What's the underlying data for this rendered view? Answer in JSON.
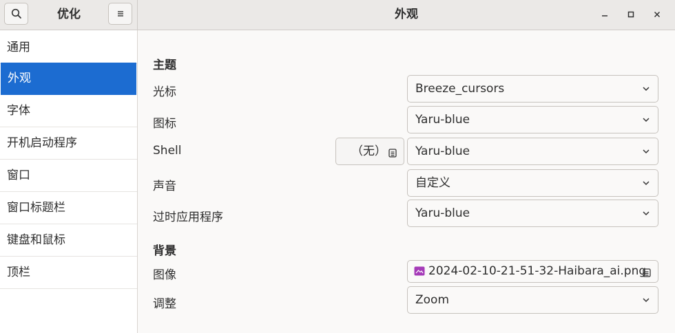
{
  "sidebar_header": {
    "title": "优化"
  },
  "window": {
    "title": "外观"
  },
  "sidebar": {
    "items": [
      {
        "label": "通用"
      },
      {
        "label": "外观"
      },
      {
        "label": "字体"
      },
      {
        "label": "开机启动程序"
      },
      {
        "label": "窗口"
      },
      {
        "label": "窗口标题栏"
      },
      {
        "label": "键盘和鼠标"
      },
      {
        "label": "顶栏"
      }
    ],
    "selected": "外观"
  },
  "main": {
    "theme_section": "主题",
    "rows": {
      "cursor": {
        "label": "光标",
        "value": "Breeze_cursors"
      },
      "icons": {
        "label": "图标",
        "value": "Yaru-blue"
      },
      "shell": {
        "label": "Shell",
        "value": "Yaru-blue",
        "none_button": "（无）"
      },
      "sound": {
        "label": "声音",
        "value": "自定义"
      },
      "legacy": {
        "label": "过时应用程序",
        "value": "Yaru-blue"
      }
    },
    "background_section": "背景",
    "image": {
      "label": "图像",
      "value": "2024-02-10-21-51-32-Haibara_ai.png"
    },
    "adjust": {
      "label": "调整",
      "value": "Zoom"
    }
  },
  "colors": {
    "accent": "#1c6cd1",
    "image_icon": "#a53bb8"
  },
  "icons": {
    "search": "search-icon",
    "menu": "hamburger-menu-icon",
    "minimize": "minimize-icon",
    "maximize": "maximize-icon",
    "close": "close-icon",
    "dropdown": "chevron-down-icon",
    "file_chooser": "document-open-icon",
    "image": "image-file-icon"
  }
}
